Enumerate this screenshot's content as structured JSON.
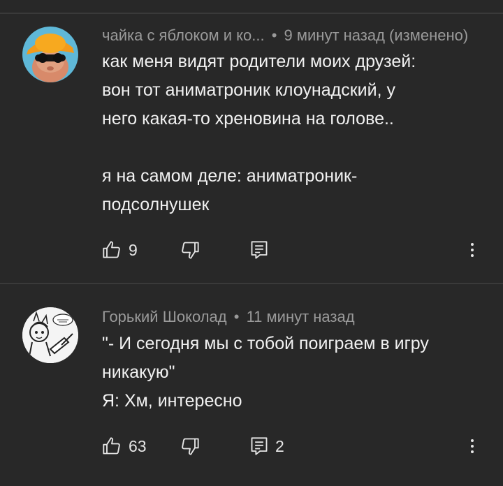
{
  "comments": [
    {
      "author": "чайка с яблоком и ко...",
      "separator": "•",
      "time": "9 минут назад (изменено)",
      "paragraphs": [
        "как меня видят родители моих друзей:\nвон тот аниматроник клоунадский, у\nнего какая-то хреновина на голове..",
        "я на самом деле: аниматроник-\nподсолнушек"
      ],
      "likes": "9",
      "replies": "",
      "avatar_icon": "orange-hat-cat-avatar"
    },
    {
      "author": "Горький Шоколад",
      "separator": "•",
      "time": "11 минут назад",
      "paragraphs": [
        "\"- И сегодня мы с тобой поиграем в игру\nникакую\"\nЯ: Хм, интересно"
      ],
      "likes": "63",
      "replies": "2",
      "avatar_icon": "sketch-character-avatar"
    }
  ],
  "icons": {
    "like": "thumbs-up-icon",
    "dislike": "thumbs-down-icon",
    "reply": "reply-icon",
    "more": "more-vertical-icon"
  },
  "colors": {
    "background": "#282828",
    "text": "#f1f1f1",
    "meta": "#9a9a9a",
    "divider": "#3a3a3a"
  }
}
